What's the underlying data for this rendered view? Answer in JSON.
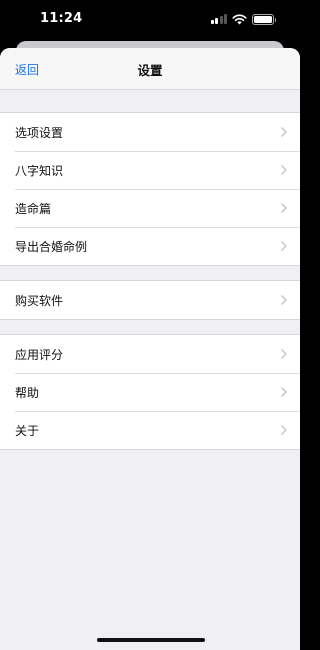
{
  "status_bar": {
    "time": "11:24"
  },
  "nav": {
    "back_label": "返回",
    "title": "设置"
  },
  "groups": [
    {
      "items": [
        {
          "label": "选项设置"
        },
        {
          "label": "八字知识"
        },
        {
          "label": "造命篇"
        },
        {
          "label": "导出合婚命例"
        }
      ]
    },
    {
      "items": [
        {
          "label": "购买软件"
        }
      ]
    },
    {
      "items": [
        {
          "label": "应用评分"
        },
        {
          "label": "帮助"
        },
        {
          "label": "关于"
        }
      ]
    }
  ],
  "colors": {
    "accent": "#1a73e8",
    "grouped_background": "#efeff4",
    "cell_background": "#ffffff",
    "chevron": "#c4c4c7"
  },
  "icons": {
    "row_accessory": "chevron-right-icon"
  }
}
